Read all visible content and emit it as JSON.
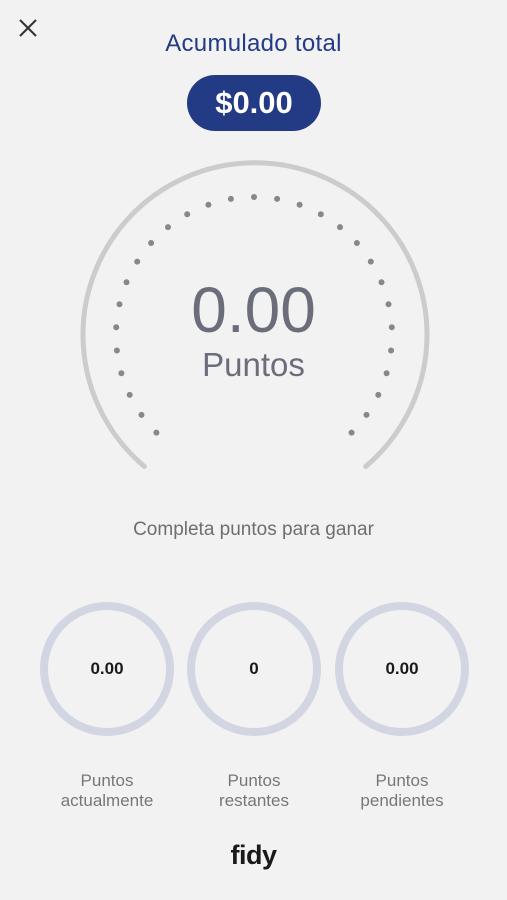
{
  "header": {
    "title": "Acumulado total",
    "total": "$0.00"
  },
  "gauge": {
    "value": "0.00",
    "label": "Puntos",
    "progress": 0
  },
  "subtitle": "Completa puntos para ganar",
  "stats": [
    {
      "value": "0.00",
      "label": "Puntos\nactualmente"
    },
    {
      "value": "0",
      "label": "Puntos\nrestantes"
    },
    {
      "value": "0.00",
      "label": "Puntos\npendientes"
    }
  ],
  "brand": "fidy",
  "colors": {
    "primary": "#233a84",
    "ring": "#d2d6e2",
    "gauge_track": "#cccccc",
    "background": "#f2f2f2"
  },
  "icons": {
    "close": "close-icon"
  }
}
